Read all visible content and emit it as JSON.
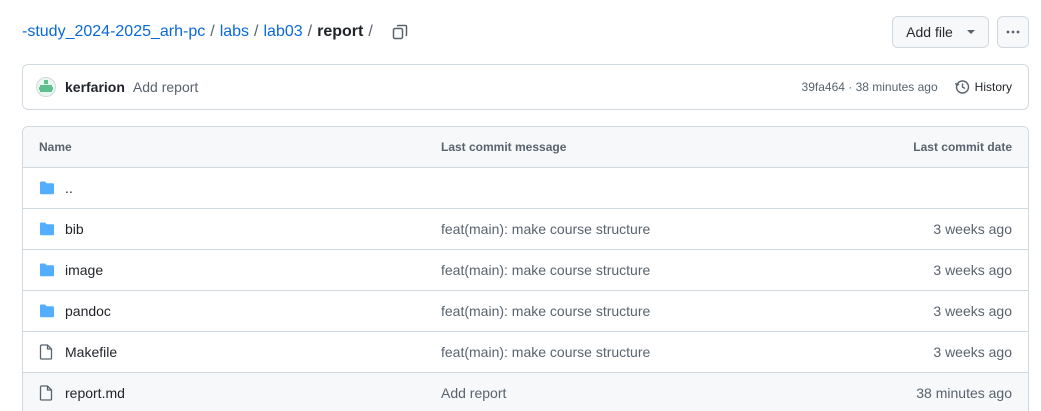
{
  "breadcrumb": {
    "repo": "-study_2024-2025_arh-pc",
    "parts": [
      "labs",
      "lab03"
    ],
    "current": "report",
    "separator": "/"
  },
  "toolbar": {
    "add_file_label": "Add file",
    "more_icon": "kebab-horizontal-icon"
  },
  "latest_commit": {
    "author": "kerfarion",
    "message": "Add report",
    "meta": "39fa464 · 38 minutes ago",
    "history_label": "History"
  },
  "table": {
    "headers": {
      "name": "Name",
      "message": "Last commit message",
      "date": "Last commit date"
    },
    "rows": [
      {
        "icon": "folder-icon",
        "name": "..",
        "message": "",
        "date": ""
      },
      {
        "icon": "folder-icon",
        "name": "bib",
        "message": "feat(main): make course structure",
        "date": "3 weeks ago"
      },
      {
        "icon": "folder-icon",
        "name": "image",
        "message": "feat(main): make course structure",
        "date": "3 weeks ago"
      },
      {
        "icon": "folder-icon",
        "name": "pandoc",
        "message": "feat(main): make course structure",
        "date": "3 weeks ago"
      },
      {
        "icon": "file-icon",
        "name": "Makefile",
        "message": "feat(main): make course structure",
        "date": "3 weeks ago"
      },
      {
        "icon": "file-icon",
        "name": "report.md",
        "message": "Add report",
        "date": "38 minutes ago"
      }
    ]
  },
  "colors": {
    "link": "#0969da",
    "folder": "#54aeff",
    "muted": "#59636e",
    "border": "#d1d9e0"
  }
}
